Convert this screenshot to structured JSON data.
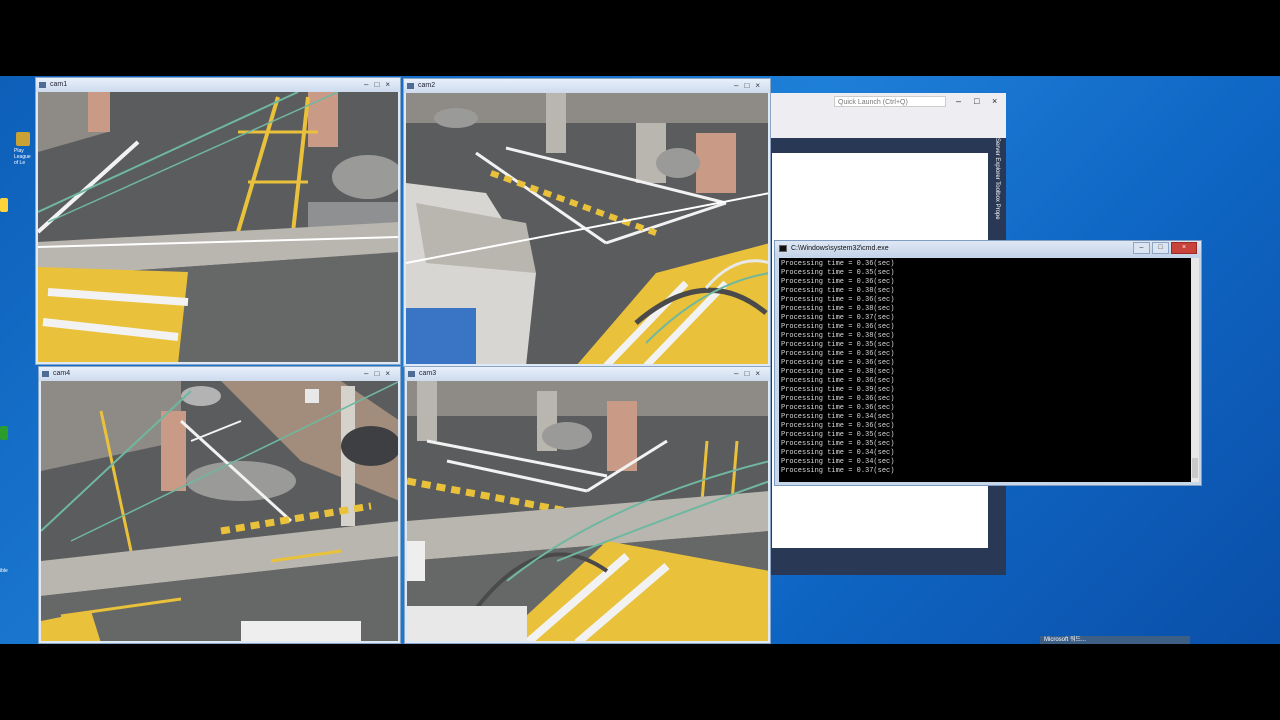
{
  "desktop": {
    "icons": [
      {
        "label": "Play League of Le",
        "color": "#c9a135",
        "icon": "game-icon"
      },
      {
        "label": "",
        "color": "#ffd43b",
        "icon": "folder-icon"
      },
      {
        "label": "",
        "color": "#2a9d2a",
        "icon": "app-icon"
      },
      {
        "label": "ible",
        "color": "#e0b020",
        "icon": "app-icon"
      }
    ],
    "taskbar_item": "Microsoft 워드..."
  },
  "visual_studio": {
    "quick_launch_placeholder": "Quick Launch (Ctrl+Q)",
    "side_tabs": "Server Explorer  Toolbox  Prope"
  },
  "cameras": [
    {
      "id": "cam1",
      "title": "cam1"
    },
    {
      "id": "cam2",
      "title": "cam2"
    },
    {
      "id": "cam4",
      "title": "cam4"
    },
    {
      "id": "cam3",
      "title": "cam3"
    }
  ],
  "window_controls": {
    "minimize": "–",
    "maximize": "□",
    "close": "×"
  },
  "cmd": {
    "title": "C:\\Windows\\system32\\cmd.exe",
    "lines": [
      "Processing time = 0.36(sec)",
      "Processing time = 0.35(sec)",
      "Processing time = 0.36(sec)",
      "Processing time = 0.38(sec)",
      "Processing time = 0.36(sec)",
      "Processing time = 0.38(sec)",
      "Processing time = 0.37(sec)",
      "Processing time = 0.36(sec)",
      "Processing time = 0.38(sec)",
      "Processing time = 0.35(sec)",
      "Processing time = 0.36(sec)",
      "Processing time = 0.36(sec)",
      "Processing time = 0.38(sec)",
      "Processing time = 0.36(sec)",
      "Processing time = 0.39(sec)",
      "Processing time = 0.36(sec)",
      "Processing time = 0.36(sec)",
      "Processing time = 0.34(sec)",
      "Processing time = 0.36(sec)",
      "Processing time = 0.35(sec)",
      "Processing time = 0.35(sec)",
      "Processing time = 0.34(sec)",
      "Processing time = 0.34(sec)",
      "Processing time = 0.37(sec)"
    ]
  },
  "colors": {
    "asphalt": "#5b5c5e",
    "yellow_line": "#e9c13a",
    "white_line": "#f2f2f2",
    "concrete": "#b9b6b0",
    "car": "#9a9a98",
    "cable": "#6fb7a0"
  }
}
